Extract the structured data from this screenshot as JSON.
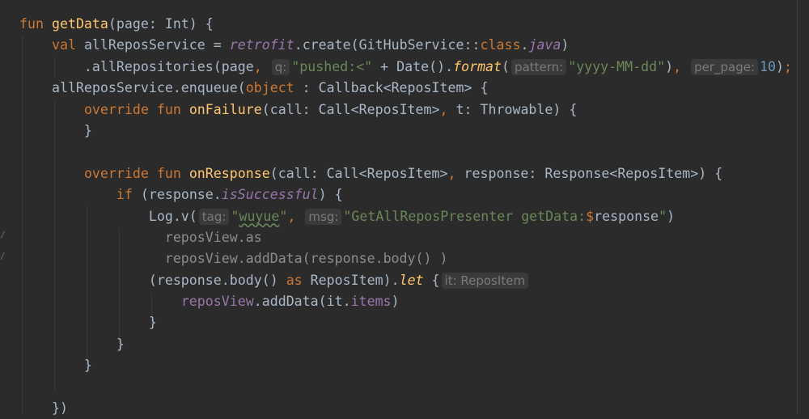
{
  "editor": {
    "language": "Kotlin",
    "colors": {
      "background": "#2b2b2b",
      "text": "#a9b7c6",
      "keyword": "#cc7832",
      "string": "#6a8759",
      "number": "#6897bb",
      "property": "#9876aa",
      "function": "#ffc66d"
    },
    "lines": [
      [
        {
          "t": "fun ",
          "k": "keyword"
        },
        {
          "t": "getData",
          "k": "fn-decl"
        },
        {
          "t": "(page: Int) {",
          "k": "plain"
        }
      ],
      [
        {
          "t": "    ",
          "k": "plain"
        },
        {
          "t": "val ",
          "k": "keyword"
        },
        {
          "t": "allReposService = ",
          "k": "plain"
        },
        {
          "t": "retrofit",
          "k": "italic-prop"
        },
        {
          "t": ".create(GitHubService::",
          "k": "plain"
        },
        {
          "t": "class",
          "k": "keyword"
        },
        {
          "t": ".",
          "k": "plain"
        },
        {
          "t": "java",
          "k": "italic-prop"
        },
        {
          "t": ")",
          "k": "plain"
        }
      ],
      [
        {
          "t": "        .allRepositories(page",
          "k": "plain"
        },
        {
          "t": ", ",
          "k": "keyword"
        },
        {
          "t": "q:",
          "k": "hint"
        },
        {
          "t": "\"pushed:<\"",
          "k": "string"
        },
        {
          "t": " + Date().",
          "k": "plain"
        },
        {
          "t": "format",
          "k": "italic-fn"
        },
        {
          "t": "(",
          "k": "plain"
        },
        {
          "t": "pattern:",
          "k": "hint"
        },
        {
          "t": "\"yyyy-MM-dd\"",
          "k": "string"
        },
        {
          "t": ")",
          "k": "plain"
        },
        {
          "t": ", ",
          "k": "keyword"
        },
        {
          "t": "per_page:",
          "k": "hint"
        },
        {
          "t": "10",
          "k": "number"
        },
        {
          "t": ")",
          "k": "plain"
        },
        {
          "t": ";",
          "k": "keyword"
        }
      ],
      [
        {
          "t": "    allReposService.enqueue(",
          "k": "plain"
        },
        {
          "t": "object",
          "k": "keyword"
        },
        {
          "t": " : Callback<ReposItem> {",
          "k": "plain"
        }
      ],
      [
        {
          "t": "        ",
          "k": "plain"
        },
        {
          "t": "override fun ",
          "k": "keyword"
        },
        {
          "t": "onFailure",
          "k": "fn-decl"
        },
        {
          "t": "(call: Call<ReposItem>",
          "k": "plain"
        },
        {
          "t": ", ",
          "k": "keyword"
        },
        {
          "t": "t: Throwable) {",
          "k": "plain"
        }
      ],
      [
        {
          "t": "        }",
          "k": "plain"
        }
      ],
      [],
      [
        {
          "t": "        ",
          "k": "plain"
        },
        {
          "t": "override fun ",
          "k": "keyword"
        },
        {
          "t": "onResponse",
          "k": "fn-decl"
        },
        {
          "t": "(call: Call<ReposItem>",
          "k": "plain"
        },
        {
          "t": ", ",
          "k": "keyword"
        },
        {
          "t": "response: Response<ReposItem>) {",
          "k": "plain"
        }
      ],
      [
        {
          "t": "            ",
          "k": "plain"
        },
        {
          "t": "if ",
          "k": "keyword"
        },
        {
          "t": "(response.",
          "k": "plain"
        },
        {
          "t": "isSuccessful",
          "k": "italic-prop"
        },
        {
          "t": ") {",
          "k": "plain"
        }
      ],
      [
        {
          "t": "                Log.v(",
          "k": "plain"
        },
        {
          "t": "tag:",
          "k": "hint"
        },
        {
          "t": "\"",
          "k": "string"
        },
        {
          "t": "wuyue",
          "k": "string typo"
        },
        {
          "t": "\"",
          "k": "string"
        },
        {
          "t": ", ",
          "k": "keyword"
        },
        {
          "t": "msg:",
          "k": "hint"
        },
        {
          "t": "\"GetAllReposPresenter getData:",
          "k": "string"
        },
        {
          "t": "$",
          "k": "keyword"
        },
        {
          "t": "response",
          "k": "plain"
        },
        {
          "t": "\"",
          "k": "string"
        },
        {
          "t": ")",
          "k": "plain"
        }
      ],
      [
        {
          "t": "                  reposView.as",
          "k": "unused"
        }
      ],
      [
        {
          "t": "                  reposView.addData(response.body() )",
          "k": "unused"
        }
      ],
      [
        {
          "t": "                (response.body() ",
          "k": "plain"
        },
        {
          "t": "as ",
          "k": "keyword"
        },
        {
          "t": "ReposItem).",
          "k": "plain"
        },
        {
          "t": "let",
          "k": "italic-fn"
        },
        {
          "t": " {",
          "k": "plain"
        },
        {
          "t": "it: ReposItem",
          "k": "hint"
        }
      ],
      [
        {
          "t": "                    ",
          "k": "plain"
        },
        {
          "t": "reposView",
          "k": "property"
        },
        {
          "t": ".addData(",
          "k": "plain"
        },
        {
          "t": "it",
          "k": "plain"
        },
        {
          "t": ".",
          "k": "plain"
        },
        {
          "t": "items",
          "k": "property"
        },
        {
          "t": ")",
          "k": "plain"
        }
      ],
      [
        {
          "t": "                }",
          "k": "plain"
        }
      ],
      [
        {
          "t": "            }",
          "k": "plain"
        }
      ],
      [
        {
          "t": "        }",
          "k": "plain"
        }
      ],
      [],
      [
        {
          "t": "    })",
          "k": "plain"
        }
      ]
    ]
  }
}
